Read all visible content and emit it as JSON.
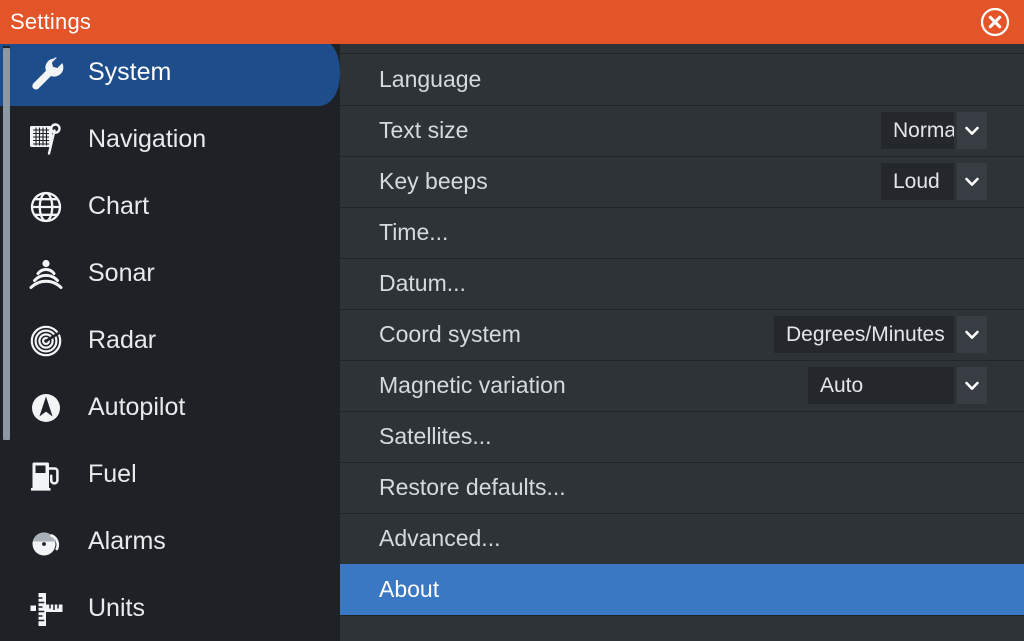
{
  "window": {
    "title": "Settings",
    "close_icon": "close-circle-icon",
    "accent_color": "#e35428",
    "selection_color": "#3b78c3",
    "sidebar_active_color": "#1e4d8c",
    "panel_bg": "#2e3338",
    "sidebar_bg": "#1e2226"
  },
  "sidebar": {
    "items": [
      {
        "label": "System",
        "icon": "wrench-icon",
        "active": true
      },
      {
        "label": "Navigation",
        "icon": "navigation-icon",
        "active": false
      },
      {
        "label": "Chart",
        "icon": "globe-icon",
        "active": false
      },
      {
        "label": "Sonar",
        "icon": "sonar-icon",
        "active": false
      },
      {
        "label": "Radar",
        "icon": "radar-icon",
        "active": false
      },
      {
        "label": "Autopilot",
        "icon": "autopilot-icon",
        "active": false
      },
      {
        "label": "Fuel",
        "icon": "fuel-pump-icon",
        "active": false
      },
      {
        "label": "Alarms",
        "icon": "alarm-bell-icon",
        "active": false
      },
      {
        "label": "Units",
        "icon": "ruler-icon",
        "active": false
      }
    ],
    "scrollbar": {
      "visible": true
    }
  },
  "settings": {
    "rows": [
      {
        "label": "Language",
        "type": "link",
        "selected": false
      },
      {
        "label": "Text size",
        "type": "dropdown",
        "value": "Normal",
        "selected": false
      },
      {
        "label": "Key beeps",
        "type": "dropdown",
        "value": "Loud",
        "selected": false
      },
      {
        "label": "Time...",
        "type": "link",
        "selected": false
      },
      {
        "label": "Datum...",
        "type": "link",
        "selected": false
      },
      {
        "label": "Coord system",
        "type": "dropdown",
        "value": "Degrees/Minutes",
        "selected": false
      },
      {
        "label": "Magnetic variation",
        "type": "dropdown",
        "value": "Auto",
        "selected": false
      },
      {
        "label": "Satellites...",
        "type": "link",
        "selected": false
      },
      {
        "label": "Restore defaults...",
        "type": "link",
        "selected": false
      },
      {
        "label": "Advanced...",
        "type": "link",
        "selected": false
      },
      {
        "label": "About",
        "type": "link",
        "selected": true
      }
    ],
    "dropdown_arrow_icon": "chevron-down-icon"
  }
}
